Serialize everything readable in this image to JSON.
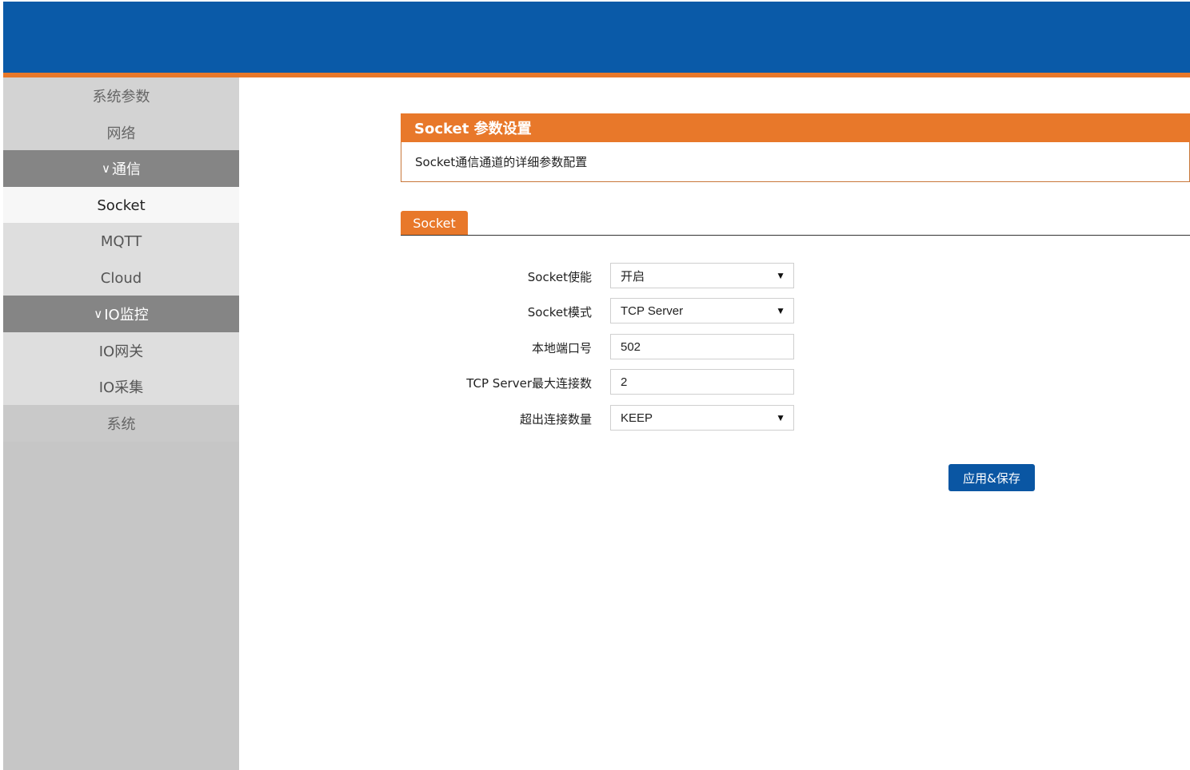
{
  "colors": {
    "header_blue": "#0a5aa8",
    "accent_orange": "#e8782a",
    "button_blue": "#0a56a3"
  },
  "sidebar": {
    "items": [
      {
        "label": "系统参数"
      },
      {
        "label": "网络"
      },
      {
        "label": "通信",
        "expanded": true
      },
      {
        "label": "Socket",
        "active": true
      },
      {
        "label": "MQTT"
      },
      {
        "label": "Cloud"
      },
      {
        "label": "IO监控",
        "expanded": true
      },
      {
        "label": "IO网关"
      },
      {
        "label": "IO采集"
      },
      {
        "label": "系统"
      }
    ]
  },
  "panel": {
    "title": "Socket 参数设置",
    "description": "Socket通信通道的详细参数配置"
  },
  "tabs": [
    {
      "label": "Socket",
      "active": true
    }
  ],
  "form": {
    "fields": [
      {
        "label": "Socket使能",
        "value": "开启",
        "type": "select"
      },
      {
        "label": "Socket模式",
        "value": "TCP Server",
        "type": "select"
      },
      {
        "label": "本地端口号",
        "value": "502",
        "type": "input"
      },
      {
        "label": "TCP Server最大连接数",
        "value": "2",
        "type": "input"
      },
      {
        "label": "超出连接数量",
        "value": "KEEP",
        "type": "select"
      }
    ],
    "save_label": "应用&保存"
  }
}
